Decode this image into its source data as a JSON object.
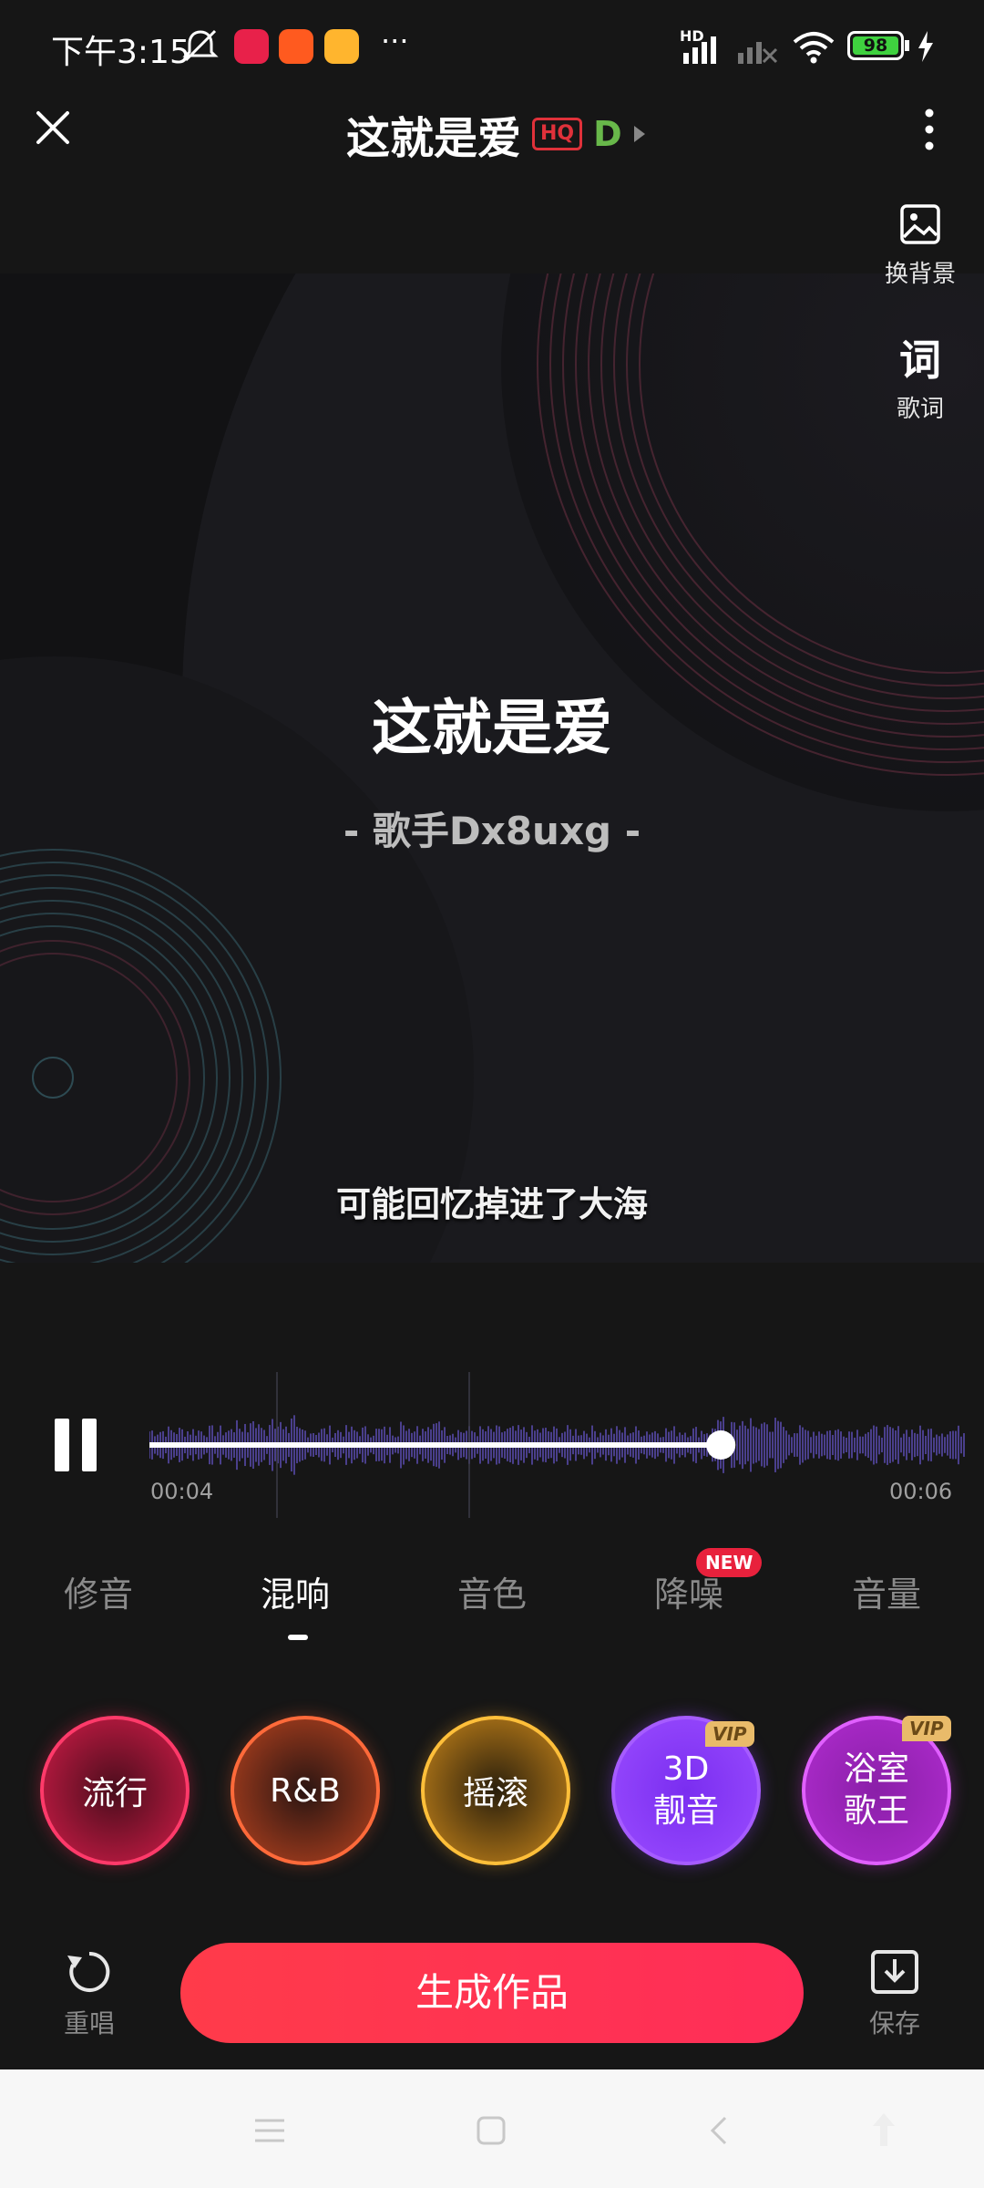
{
  "status_bar": {
    "time": "下午3:15",
    "more": "···",
    "network_label": "HD",
    "battery": "98"
  },
  "header": {
    "title": "这就是爱",
    "hq_badge": "HQ",
    "d_badge": "D"
  },
  "side_actions": [
    {
      "label": "换背景",
      "icon": "image-icon"
    },
    {
      "label": "歌词",
      "icon": "lyrics-icon",
      "glyph": "词"
    }
  ],
  "artwork": {
    "song_title": "这就是爱",
    "artist_line": "- 歌手Dx8uxg -",
    "current_lyric": "可能回忆掉进了大海"
  },
  "player": {
    "state": "playing",
    "elapsed": "00:04",
    "total": "00:06",
    "progress": 0.7
  },
  "tabs": [
    {
      "label": "修音",
      "active": false
    },
    {
      "label": "混响",
      "active": true
    },
    {
      "label": "音色",
      "active": false
    },
    {
      "label": "降噪",
      "active": false,
      "badge": "NEW"
    },
    {
      "label": "音量",
      "active": false
    }
  ],
  "effects": [
    {
      "label": "流行",
      "color": "#e8214a"
    },
    {
      "label": "R&B",
      "color": "#f0582c"
    },
    {
      "label": "摇滚",
      "color": "#f5a623"
    },
    {
      "label_line1": "3D",
      "label_line2": "靓音",
      "color": "#8a3cf0",
      "vip": "VIP"
    },
    {
      "label_line1": "浴室",
      "label_line2": "歌王",
      "color": "#c12fd6",
      "vip": "VIP"
    }
  ],
  "bottom": {
    "redo_label": "重唱",
    "generate_label": "生成作品",
    "save_label": "保存"
  }
}
